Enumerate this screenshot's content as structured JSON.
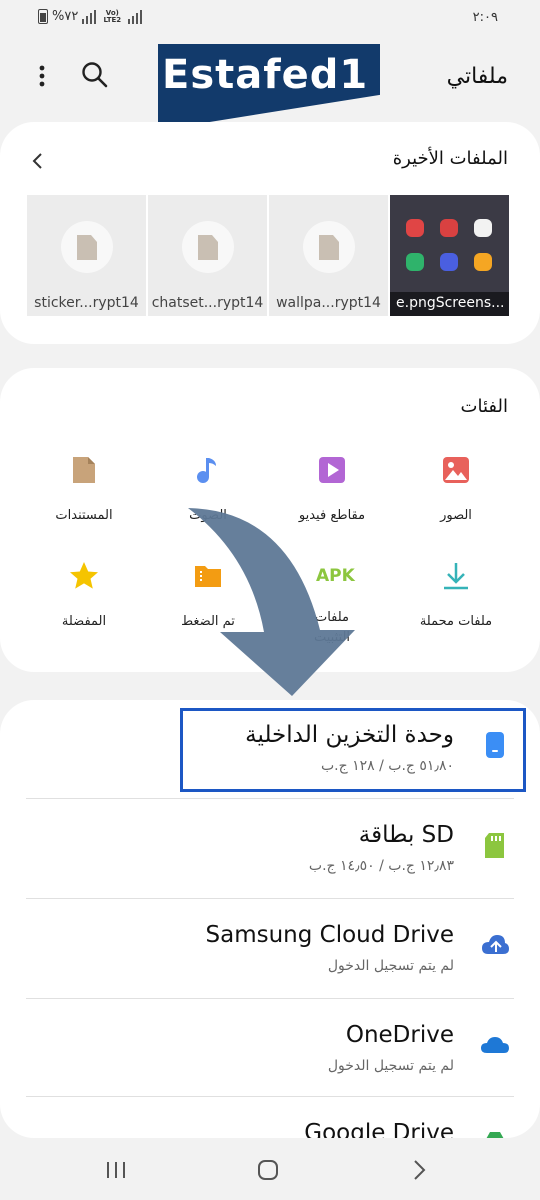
{
  "status_bar": {
    "battery_text": "%٧٢",
    "signal_label": "Vo) LTE2",
    "time": "٢:٠٩"
  },
  "header": {
    "title": "ملفاتي",
    "watermark": "Estafed1",
    "more_icon": "more-vert-icon",
    "search_icon": "search-icon"
  },
  "recent": {
    "title": "الملفات الأخيرة",
    "files": [
      {
        "label": "e.pngScreens...",
        "type": "screenshot"
      },
      {
        "label": "wallpa...rypt14",
        "type": "file"
      },
      {
        "label": "chatset...rypt14",
        "type": "file"
      },
      {
        "label": "sticker...rypt14",
        "type": "file"
      }
    ]
  },
  "categories": {
    "title": "الفئات",
    "items": [
      {
        "label": "الصور",
        "icon": "image-icon",
        "color": "#e8615b"
      },
      {
        "label": "مقاطع فيديو",
        "icon": "video-icon",
        "color": "#b266d4"
      },
      {
        "label": "الصوت",
        "icon": "music-icon",
        "color": "#5b8ff0"
      },
      {
        "label": "المستندات",
        "icon": "document-icon",
        "color": "#c8a37a"
      },
      {
        "label": "ملفات محملة",
        "icon": "download-icon",
        "color": "#35b3b8"
      },
      {
        "label": "ملفات التثبيت",
        "icon": "apk-icon",
        "icon_text": "APK",
        "color": "#8cc63f"
      },
      {
        "label": "تم الضغط",
        "icon": "zip-icon",
        "color": "#f39c12"
      },
      {
        "label": "المفضلة",
        "icon": "star-icon",
        "color": "#f5c400"
      }
    ]
  },
  "storage": {
    "items": [
      {
        "name": "وحدة التخزين الداخلية",
        "sub": "٥١٫٨٠ ج.ب / ١٢٨ ج.ب",
        "icon": "phone-storage-icon",
        "color": "#3b8ef5"
      },
      {
        "name": "بطاقة SD",
        "sub": "١٢٫٨٣ ج.ب / ١٤٫٥٠ ج.ب",
        "icon": "sd-card-icon",
        "color": "#8cc63f"
      },
      {
        "name": "Samsung Cloud Drive",
        "sub": "لم يتم تسجيل الدخول",
        "icon": "cloud-upload-icon",
        "color": "#3b6fd1"
      },
      {
        "name": "OneDrive",
        "sub": "لم يتم تسجيل الدخول",
        "icon": "onedrive-icon",
        "color": "#1e78d6"
      },
      {
        "name": "Google Drive",
        "sub": "",
        "icon": "google-drive-icon",
        "color": "#34a853"
      }
    ]
  },
  "nav": {
    "recents_icon": "recents-icon",
    "home_icon": "home-icon",
    "back_icon": "back-icon"
  },
  "colors": {
    "highlight": "#1c57c4",
    "arrow": "#5e7896",
    "watermark_bg": "#123a6b"
  }
}
